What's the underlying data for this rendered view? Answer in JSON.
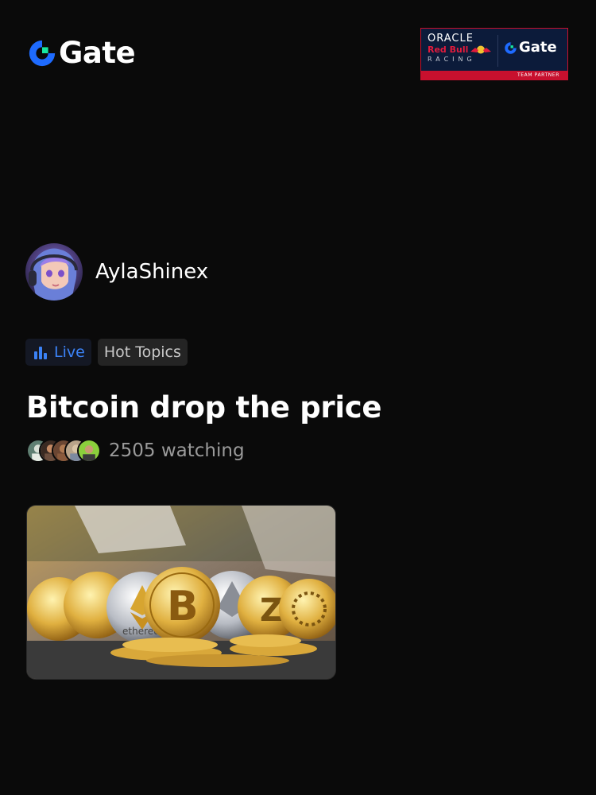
{
  "header": {
    "brand_name": "Gate",
    "logo_icon": "gate-logo-icon",
    "brand_color": "#1e6bff",
    "accent_color": "#17e6a1",
    "partner_badge": {
      "oracle": "ORACLE",
      "red_bull": "Red Bull",
      "racing": "RACING",
      "brand": "Gate",
      "caption": "TEAM PARTNER",
      "background_color": "#0c1b3a",
      "stripe_color": "#c8102e"
    }
  },
  "host": {
    "name": "AylaShinex",
    "avatar_icon": "avatar-anime-girl"
  },
  "tags": {
    "live_label": "Live",
    "live_icon": "bar-chart-icon",
    "live_color": "#3b82f6",
    "topic_label": "Hot Topics"
  },
  "stream": {
    "title": "Bitcoin drop the price",
    "watching_count": "2505",
    "watching_text": "2505 watching",
    "viewer_avatars": [
      "viewer-avatar-1",
      "viewer-avatar-2",
      "viewer-avatar-3",
      "viewer-avatar-4",
      "viewer-avatar-5"
    ],
    "thumbnail": {
      "icon": "crypto-coins-image",
      "coin_text": "ethereum"
    }
  }
}
